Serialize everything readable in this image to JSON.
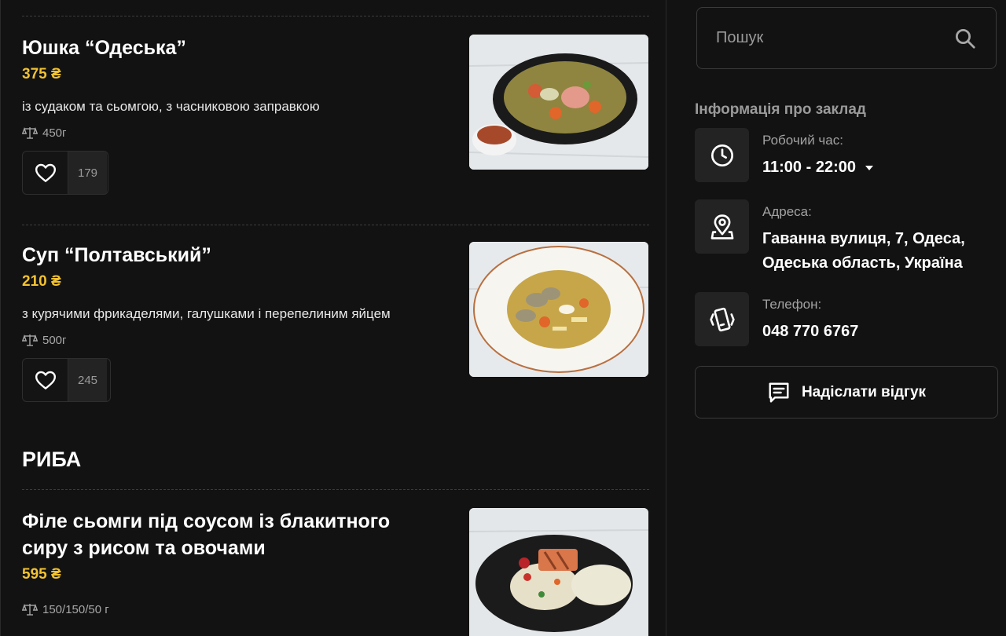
{
  "dishes": [
    {
      "title": "Юшка “Одеська”",
      "price": "375 ₴",
      "description": "із судаком та сьомгою, з часниковою заправкою",
      "weight": "450г",
      "likes": "179"
    },
    {
      "title": "Суп “Полтавський”",
      "price": "210 ₴",
      "description": "з курячими фрикаделями, галушками і перепелиним яйцем",
      "weight": "500г",
      "likes": "245"
    }
  ],
  "section": {
    "title": "РИБА"
  },
  "fish_dish": {
    "title_line1": "Філе сьомги під соусом із блакитного",
    "title_line2": "сиру з рисом та овочами",
    "price": "595 ₴",
    "weight": "150/150/50 г"
  },
  "sidebar": {
    "search_placeholder": "Пошук",
    "info_heading": "Інформація про заклад",
    "hours_label": "Робочий час:",
    "hours_value": "11:00 - 22:00",
    "address_label": "Адреса:",
    "address_line1": "Гаванна вулиця, 7, Одеса,",
    "address_line2": "Одеська область, Україна",
    "phone_label": "Телефон:",
    "phone_value": "048 770 6767",
    "review_button": "Надіслати відгук"
  },
  "icons": [
    "scale-icon",
    "heart-icon",
    "search-icon",
    "clock-icon",
    "map-pin-icon",
    "phone-vibrate-icon",
    "message-icon",
    "caret-down-icon"
  ],
  "colors": {
    "background": "#121212",
    "price": "#f2c231",
    "panel": "#232323"
  }
}
